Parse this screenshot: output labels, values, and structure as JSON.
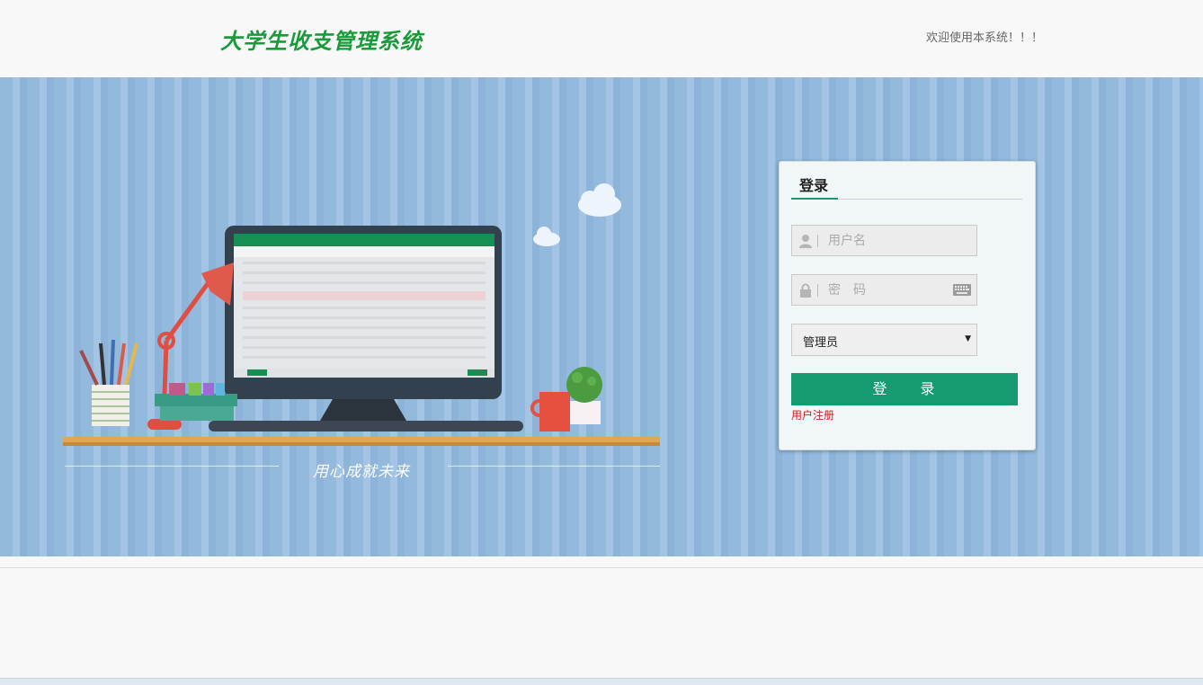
{
  "header": {
    "logo_text": "大学生收支管理系统",
    "welcome": "欢迎使用本系统！！！"
  },
  "hero": {
    "tagline": "用心成就未来"
  },
  "login": {
    "title": "登录",
    "username_placeholder": "用户名",
    "password_placeholder": "密　码",
    "role_selected": "管理员",
    "submit_label": "登 录",
    "register_link": "用户注册"
  },
  "colors": {
    "accent": "#159a72",
    "logo": "#1a9a3a",
    "register_link": "#d6171f",
    "hero_bg": "#93b9dd"
  },
  "icons": [
    "user-icon",
    "lock-icon",
    "keyboard-icon",
    "chevron-down-icon"
  ]
}
